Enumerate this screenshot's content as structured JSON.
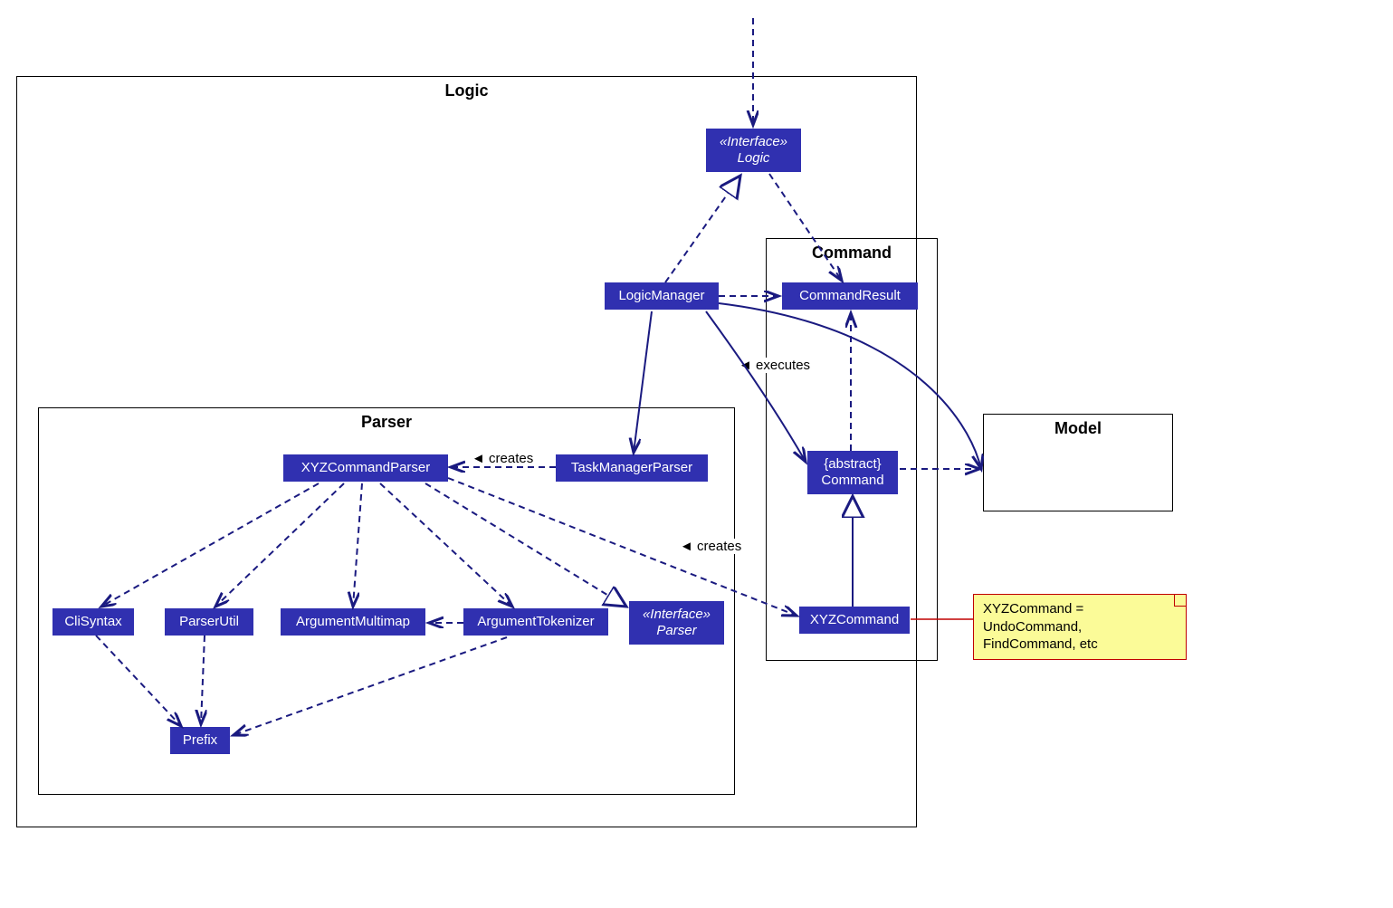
{
  "colors": {
    "node": "#3030b0",
    "noteBg": "#fbfb98",
    "noteBorder": "#c00000",
    "line": "#1a1a80"
  },
  "packages": {
    "logic": {
      "title": "Logic"
    },
    "parser": {
      "title": "Parser"
    },
    "command": {
      "title": "Command"
    },
    "model": {
      "title": "Model"
    }
  },
  "nodes": {
    "logic_interface": {
      "stereo": "«Interface»",
      "name": "Logic"
    },
    "logic_manager": {
      "name": "LogicManager"
    },
    "command_result": {
      "name": "CommandResult"
    },
    "abstract_command": {
      "stereo": "{abstract}",
      "name": "Command"
    },
    "xyz_command": {
      "name": "XYZCommand"
    },
    "task_manager_parser": {
      "name": "TaskManagerParser"
    },
    "xyz_command_parser": {
      "name": "XYZCommandParser"
    },
    "cli_syntax": {
      "name": "CliSyntax"
    },
    "parser_util": {
      "name": "ParserUtil"
    },
    "argument_multimap": {
      "name": "ArgumentMultimap"
    },
    "argument_tokenizer": {
      "name": "ArgumentTokenizer"
    },
    "parser_interface": {
      "stereo": "«Interface»",
      "name": "Parser"
    },
    "prefix": {
      "name": "Prefix"
    }
  },
  "note": {
    "line1": "XYZCommand = UndoCommand,",
    "line2": "FindCommand, etc"
  },
  "labels": {
    "executes": "executes",
    "creates1": "creates",
    "creates2": "creates"
  },
  "diagram_data": {
    "type": "uml_component_class",
    "packages": [
      "Logic",
      "Parser",
      "Command",
      "Model"
    ],
    "elements": [
      {
        "id": "Logic",
        "pkg": "Logic",
        "kind": "interface"
      },
      {
        "id": "LogicManager",
        "pkg": "Logic",
        "kind": "class"
      },
      {
        "id": "CommandResult",
        "pkg": "Command",
        "kind": "class"
      },
      {
        "id": "Command",
        "pkg": "Command",
        "kind": "abstract"
      },
      {
        "id": "XYZCommand",
        "pkg": "Command",
        "kind": "class"
      },
      {
        "id": "TaskManagerParser",
        "pkg": "Parser",
        "kind": "class"
      },
      {
        "id": "XYZCommandParser",
        "pkg": "Parser",
        "kind": "class"
      },
      {
        "id": "CliSyntax",
        "pkg": "Parser",
        "kind": "class"
      },
      {
        "id": "ParserUtil",
        "pkg": "Parser",
        "kind": "class"
      },
      {
        "id": "ArgumentMultimap",
        "pkg": "Parser",
        "kind": "class"
      },
      {
        "id": "ArgumentTokenizer",
        "pkg": "Parser",
        "kind": "class"
      },
      {
        "id": "Parser",
        "pkg": "Parser",
        "kind": "interface"
      },
      {
        "id": "Prefix",
        "pkg": "Parser",
        "kind": "class"
      }
    ],
    "relations": [
      {
        "from": "(external)",
        "to": "Logic",
        "style": "dashed-arrow",
        "kind": "dependency"
      },
      {
        "from": "LogicManager",
        "to": "Logic",
        "style": "dashed-triangle",
        "kind": "realizes"
      },
      {
        "from": "Logic",
        "to": "CommandResult",
        "style": "dashed-arrow",
        "kind": "dependency"
      },
      {
        "from": "LogicManager",
        "to": "CommandResult",
        "style": "dashed-arrow",
        "kind": "dependency"
      },
      {
        "from": "LogicManager",
        "to": "Command",
        "style": "solid-arrow",
        "label": "executes",
        "kind": "association"
      },
      {
        "from": "LogicManager",
        "to": "TaskManagerParser",
        "style": "solid-arrow",
        "kind": "association"
      },
      {
        "from": "LogicManager",
        "to": "Model",
        "style": "solid-arrow",
        "kind": "association"
      },
      {
        "from": "XYZCommand",
        "to": "Command",
        "style": "solid-triangle",
        "kind": "extends"
      },
      {
        "from": "Command",
        "to": "CommandResult",
        "style": "dashed-arrow",
        "kind": "dependency"
      },
      {
        "from": "Command",
        "to": "Model",
        "style": "dashed-arrow",
        "kind": "dependency"
      },
      {
        "from": "TaskManagerParser",
        "to": "XYZCommandParser",
        "style": "dashed-arrow",
        "label": "creates",
        "kind": "creates"
      },
      {
        "from": "XYZCommandParser",
        "to": "Parser",
        "style": "dashed-triangle",
        "kind": "realizes"
      },
      {
        "from": "XYZCommandParser",
        "to": "XYZCommand",
        "style": "dashed-arrow",
        "label": "creates",
        "kind": "creates"
      },
      {
        "from": "XYZCommandParser",
        "to": "CliSyntax",
        "style": "dashed-arrow",
        "kind": "dependency"
      },
      {
        "from": "XYZCommandParser",
        "to": "ParserUtil",
        "style": "dashed-arrow",
        "kind": "dependency"
      },
      {
        "from": "XYZCommandParser",
        "to": "ArgumentMultimap",
        "style": "dashed-arrow",
        "kind": "dependency"
      },
      {
        "from": "XYZCommandParser",
        "to": "ArgumentTokenizer",
        "style": "dashed-arrow",
        "kind": "dependency"
      },
      {
        "from": "ArgumentTokenizer",
        "to": "ArgumentMultimap",
        "style": "dashed-arrow",
        "kind": "dependency"
      },
      {
        "from": "CliSyntax",
        "to": "Prefix",
        "style": "dashed-arrow",
        "kind": "dependency"
      },
      {
        "from": "ParserUtil",
        "to": "Prefix",
        "style": "dashed-arrow",
        "kind": "dependency"
      },
      {
        "from": "ArgumentTokenizer",
        "to": "Prefix",
        "style": "dashed-arrow",
        "kind": "dependency"
      }
    ],
    "note": {
      "attachedTo": "XYZCommand",
      "text": "XYZCommand = UndoCommand, FindCommand, etc"
    }
  }
}
